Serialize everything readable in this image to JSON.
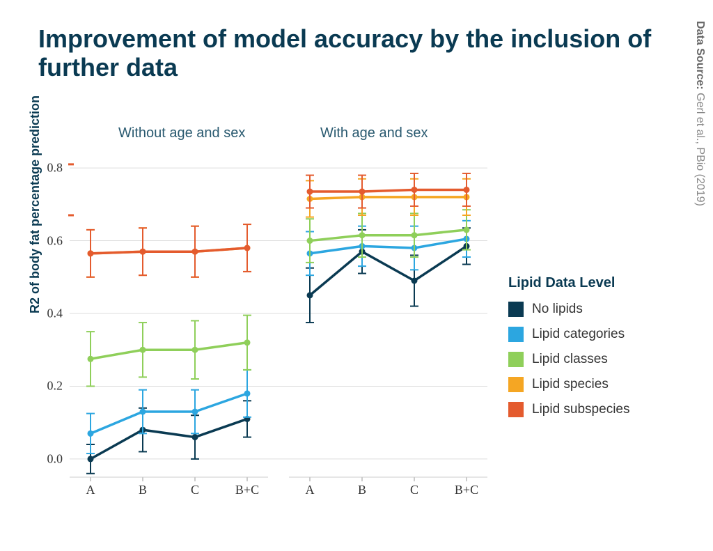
{
  "title": "Improvement of model accuracy by the inclusion of further data",
  "source_label": "Data Source:",
  "source_value": " Gerl et al., PBio (2019)",
  "ylabel": "R2 of body fat percentage prediction",
  "panels": {
    "left": "Without age and sex",
    "right": "With age and sex"
  },
  "legend_title": "Lipid Data Level",
  "legend_items": [
    {
      "label": "No lipids",
      "color": "#0a3a52"
    },
    {
      "label": "Lipid categories",
      "color": "#2ca6e0"
    },
    {
      "label": "Lipid classes",
      "color": "#8fcf5a"
    },
    {
      "label": "Lipid species",
      "color": "#f5a623"
    },
    {
      "label": "Lipid subspecies",
      "color": "#e45b2e"
    }
  ],
  "ylim": [
    -0.05,
    0.85
  ],
  "yticks": [
    0.0,
    0.2,
    0.4,
    0.6,
    0.8
  ],
  "ytick_labels": [
    "0.0",
    "0.2",
    "0.4",
    "0.6",
    "0.8"
  ],
  "categories": [
    "A",
    "B",
    "C",
    "B+C"
  ],
  "chart_data": {
    "type": "line",
    "title": "Improvement of model accuracy by the inclusion of further data",
    "ylabel": "R2 of body fat percentage prediction",
    "ylim": [
      -0.05,
      0.85
    ],
    "categories": [
      "A",
      "B",
      "C",
      "B+C"
    ],
    "facets": [
      {
        "name": "Without age and sex",
        "series": [
          {
            "name": "No lipids",
            "color": "#0a3a52",
            "values": [
              0.0,
              0.08,
              0.06,
              0.11
            ],
            "err": [
              0.04,
              0.06,
              0.06,
              0.05
            ]
          },
          {
            "name": "Lipid categories",
            "color": "#2ca6e0",
            "values": [
              0.07,
              0.13,
              0.13,
              0.18
            ],
            "err": [
              0.055,
              0.06,
              0.06,
              0.065
            ]
          },
          {
            "name": "Lipid classes",
            "color": "#8fcf5a",
            "values": [
              0.275,
              0.3,
              0.3,
              0.32
            ],
            "err": [
              0.075,
              0.075,
              0.08,
              0.075
            ]
          },
          {
            "name": "Lipid species",
            "color": "#f5a623",
            "values": [
              0.565,
              0.57,
              0.57,
              0.58
            ],
            "err": [
              0.065,
              0.065,
              0.07,
              0.065
            ]
          },
          {
            "name": "Lipid subspecies",
            "color": "#e45b2e",
            "values": [
              0.565,
              0.57,
              0.57,
              0.58
            ],
            "err": [
              0.065,
              0.065,
              0.07,
              0.065
            ]
          }
        ]
      },
      {
        "name": "With age and sex",
        "series": [
          {
            "name": "No lipids",
            "color": "#0a3a52",
            "values": [
              0.45,
              0.57,
              0.49,
              0.585
            ],
            "err": [
              0.075,
              0.06,
              0.07,
              0.05
            ]
          },
          {
            "name": "Lipid categories",
            "color": "#2ca6e0",
            "values": [
              0.565,
              0.585,
              0.58,
              0.605
            ],
            "err": [
              0.06,
              0.055,
              0.06,
              0.05
            ]
          },
          {
            "name": "Lipid classes",
            "color": "#8fcf5a",
            "values": [
              0.6,
              0.615,
              0.615,
              0.63
            ],
            "err": [
              0.06,
              0.06,
              0.06,
              0.055
            ]
          },
          {
            "name": "Lipid species",
            "color": "#f5a623",
            "values": [
              0.715,
              0.72,
              0.72,
              0.72
            ],
            "err": [
              0.05,
              0.05,
              0.05,
              0.05
            ]
          },
          {
            "name": "Lipid subspecies",
            "color": "#e45b2e",
            "values": [
              0.735,
              0.735,
              0.74,
              0.74
            ],
            "err": [
              0.045,
              0.045,
              0.045,
              0.045
            ]
          }
        ]
      }
    ]
  }
}
